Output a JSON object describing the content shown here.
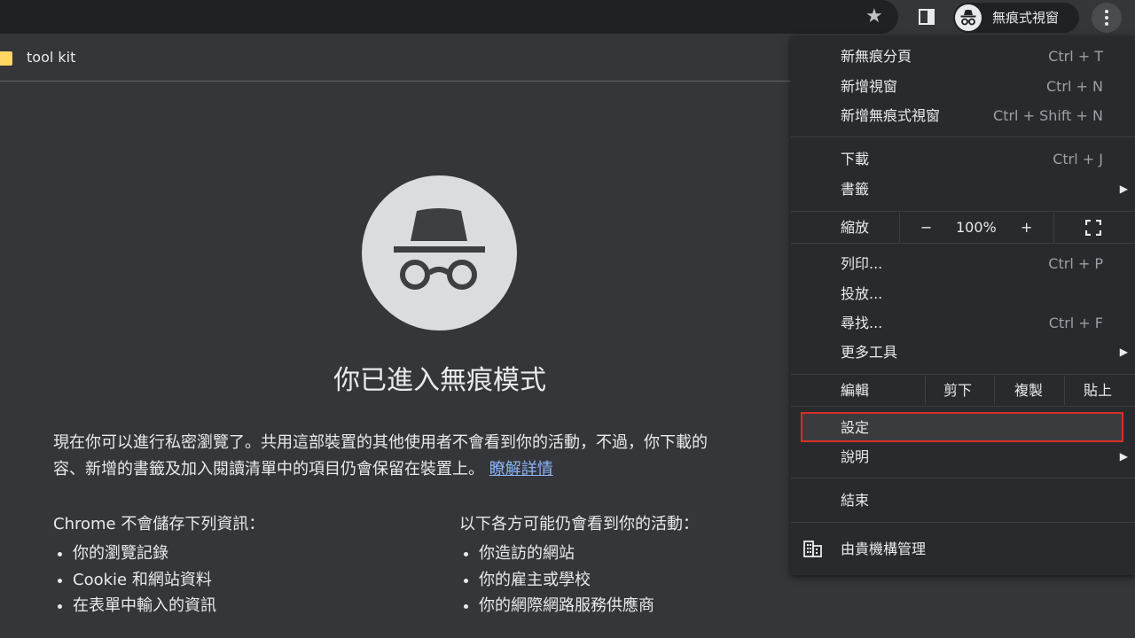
{
  "toolbar": {
    "incognito_label": "無痕式視窗"
  },
  "bookmarks": {
    "items": [
      {
        "label": "tool kit"
      }
    ]
  },
  "ntp": {
    "title": "你已進入無痕模式",
    "paragraph_line1": "現在你可以進行私密瀏覽了。共用這部裝置的其他使用者不會看到你的活動，不過，你下載的",
    "paragraph_line2": "容、新增的書籤及加入閱讀清單中的項目仍會保留在裝置上。",
    "learn_more": "瞭解詳情",
    "col1_heading": "Chrome 不會儲存下列資訊：",
    "col1_items": [
      "你的瀏覽記錄",
      "Cookie 和網站資料",
      "在表單中輸入的資訊"
    ],
    "col2_heading": "以下各方可能仍會看到你的活動：",
    "col2_items": [
      "你造訪的網站",
      "你的雇主或學校",
      "你的網際網路服務供應商"
    ]
  },
  "menu": {
    "new_incognito_tab": {
      "label": "新無痕分頁",
      "shortcut": "Ctrl + T"
    },
    "new_window": {
      "label": "新增視窗",
      "shortcut": "Ctrl + N"
    },
    "new_incognito_window": {
      "label": "新增無痕式視窗",
      "shortcut": "Ctrl + Shift + N"
    },
    "downloads": {
      "label": "下載",
      "shortcut": "Ctrl + J"
    },
    "bookmarks": {
      "label": "書籤"
    },
    "zoom": {
      "label": "縮放",
      "minus": "−",
      "value": "100%",
      "plus": "+"
    },
    "print": {
      "label": "列印...",
      "shortcut": "Ctrl + P"
    },
    "cast": {
      "label": "投放..."
    },
    "find": {
      "label": "尋找...",
      "shortcut": "Ctrl + F"
    },
    "more_tools": {
      "label": "更多工具"
    },
    "edit": {
      "label": "編輯",
      "cut": "剪下",
      "copy": "複製",
      "paste": "貼上"
    },
    "settings": {
      "label": "設定"
    },
    "help": {
      "label": "說明"
    },
    "exit": {
      "label": "結束"
    },
    "managed": {
      "label": "由貴機構管理"
    }
  },
  "colors": {
    "background": "#35363a",
    "menu_bg": "#292a2d",
    "link": "#8ab4f8",
    "highlight_border": "#d93025",
    "folder": "#fdd663"
  }
}
